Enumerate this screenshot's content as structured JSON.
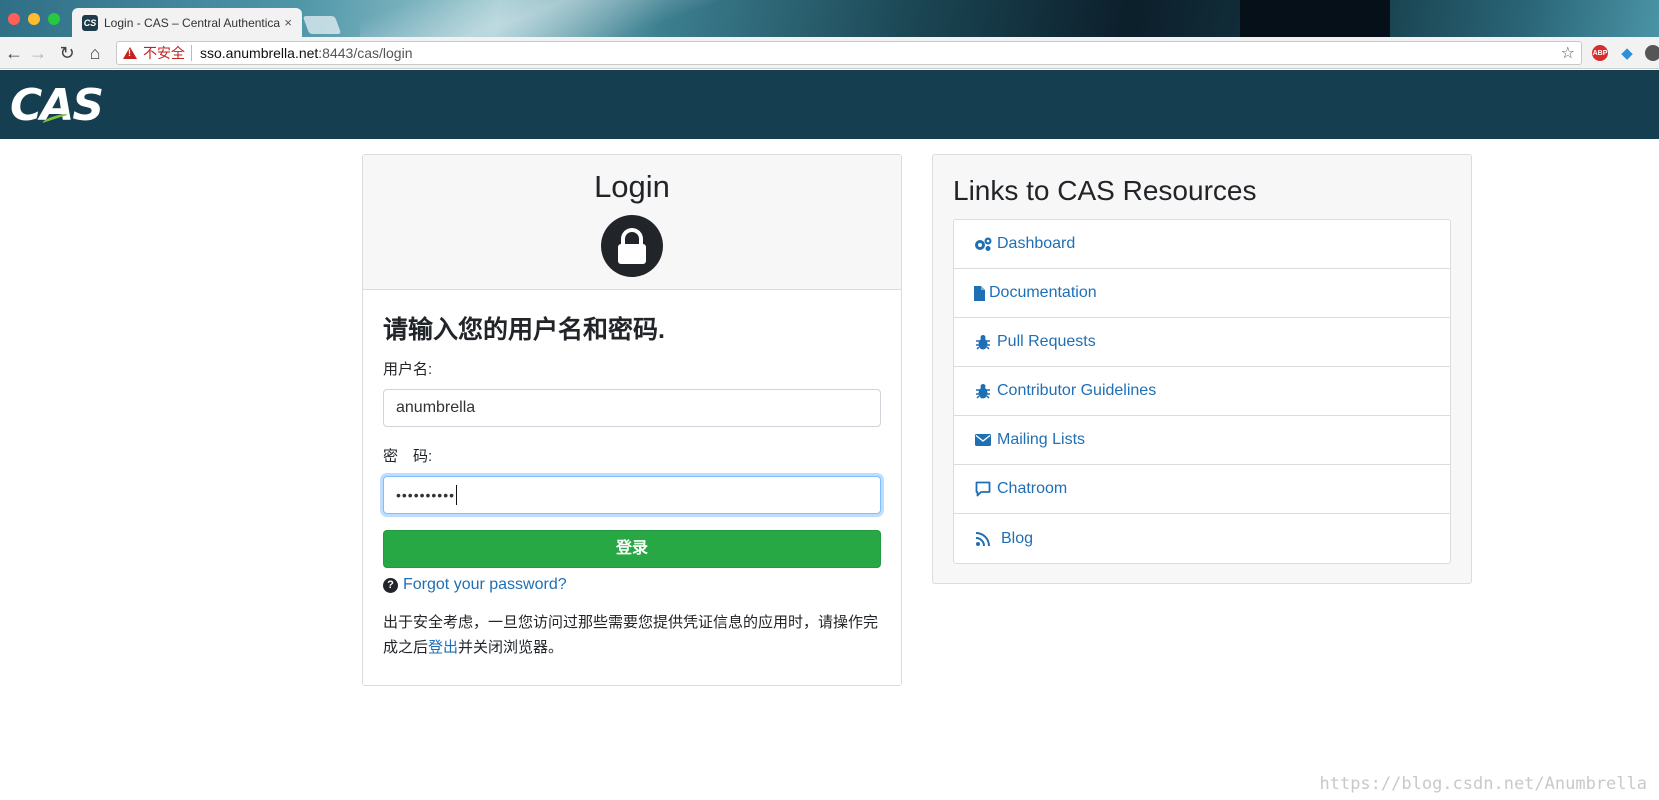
{
  "browser": {
    "tab_title": "Login - CAS – Central Authentication Service",
    "tab_favicon": "CS",
    "tab_close": "×",
    "back_glyph": "←",
    "forward_glyph": "→",
    "reload_glyph": "↻",
    "home_glyph": "⌂",
    "security_label": "不安全",
    "url_host": "sso.anumbrella.net",
    "url_rest": ":8443/cas/login",
    "star_glyph": "☆",
    "ext_abp": "ABP",
    "ext_gem": "◆"
  },
  "header": {
    "logo_text": "CAS"
  },
  "login": {
    "title": "Login",
    "prompt": "请输入您的用户名和密码.",
    "username_label": "用户名:",
    "username_value": "anumbrella",
    "password_label": "密　码:",
    "password_value": "••••••••••",
    "submit_label": "登录",
    "forgot_icon": "?",
    "forgot_label": "Forgot your password?",
    "notice_before": "出于安全考虑，一旦您访问过那些需要您提供凭证信息的应用时，请操作完成之后",
    "notice_link": "登出",
    "notice_after": "并关闭浏览器。"
  },
  "resources": {
    "title": "Links to CAS Resources",
    "items": [
      {
        "label": "Dashboard",
        "icon": "gears-icon"
      },
      {
        "label": "Documentation",
        "icon": "file-icon"
      },
      {
        "label": "Pull Requests",
        "icon": "bug-icon"
      },
      {
        "label": "Contributor Guidelines",
        "icon": "bug-icon"
      },
      {
        "label": "Mailing Lists",
        "icon": "envelope-icon"
      },
      {
        "label": "Chatroom",
        "icon": "comment-icon"
      },
      {
        "label": "Blog",
        "icon": "rss-icon"
      }
    ]
  },
  "watermark": "https://blog.csdn.net/Anumbrella",
  "colors": {
    "header_bg": "#153e50",
    "submit_green": "#28a745",
    "link_blue": "#1f6fb5"
  }
}
